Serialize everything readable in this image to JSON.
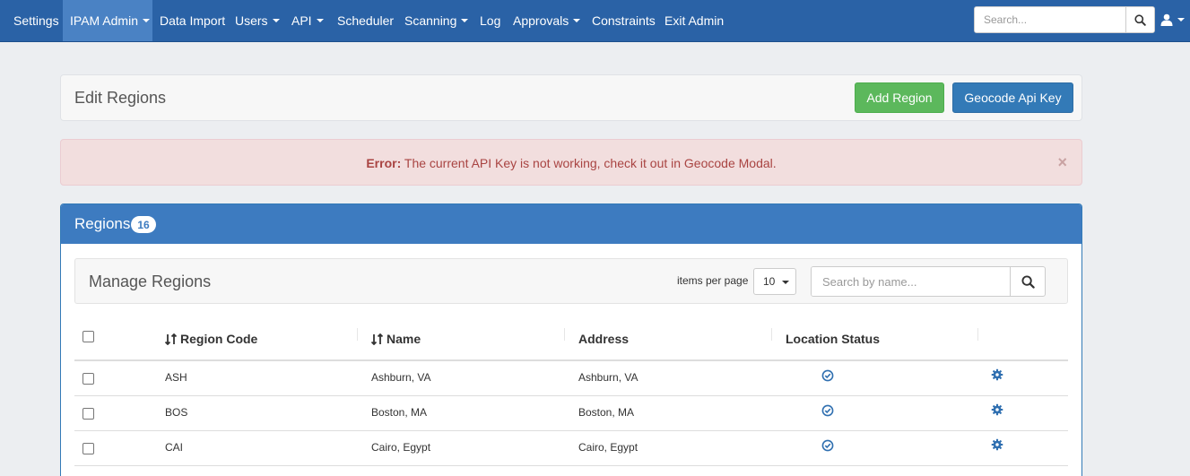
{
  "navbar": {
    "items": [
      {
        "label": "Settings",
        "dropdown": false,
        "active": false
      },
      {
        "label": "IPAM Admin",
        "dropdown": true,
        "active": true
      },
      {
        "label": "Data Import",
        "dropdown": false,
        "active": false
      },
      {
        "label": "Users",
        "dropdown": true,
        "active": false
      },
      {
        "label": "API",
        "dropdown": true,
        "active": false
      },
      {
        "label": "Scheduler",
        "dropdown": false,
        "active": false
      },
      {
        "label": "Scanning",
        "dropdown": true,
        "active": false
      },
      {
        "label": "Log",
        "dropdown": false,
        "active": false
      },
      {
        "label": "Approvals",
        "dropdown": true,
        "active": false
      },
      {
        "label": "Constraints",
        "dropdown": false,
        "active": false
      },
      {
        "label": "Exit Admin",
        "dropdown": false,
        "active": false
      }
    ],
    "search_placeholder": "Search...",
    "search_icon": "search-icon",
    "user_icon": "user-icon"
  },
  "header": {
    "title": "Edit Regions",
    "add_region_label": "Add Region",
    "geocode_label": "Geocode Api Key"
  },
  "alert": {
    "prefix": "Error:",
    "message": " The current API Key is not working, check it out  in Geocode Modal.",
    "close_symbol": "×"
  },
  "regions": {
    "title": "Regions",
    "count": "16",
    "manage_title": "Manage Regions",
    "items_per_page_label": "items per page",
    "items_per_page_value": "10",
    "search_placeholder": "Search by name...",
    "columns": [
      "Region Code",
      "Name",
      "Address",
      "Location Status"
    ],
    "rows": [
      {
        "code": "ASH",
        "name": "Ashburn, VA",
        "address": "Ashburn, VA",
        "status": "check-circle-icon"
      },
      {
        "code": "BOS",
        "name": "Boston, MA",
        "address": "Boston, MA",
        "status": "check-circle-icon"
      },
      {
        "code": "CAI",
        "name": "Cairo, Egypt",
        "address": "Cairo, Egypt",
        "status": "check-circle-icon"
      }
    ]
  },
  "colors": {
    "navbar": "#2a62a6",
    "navbar_active": "#4a82c4",
    "panel_heading": "#3d7bc0",
    "success": "#5cb85c",
    "primary": "#337ab7",
    "danger_bg": "#f2dede",
    "danger_text": "#a94442"
  }
}
